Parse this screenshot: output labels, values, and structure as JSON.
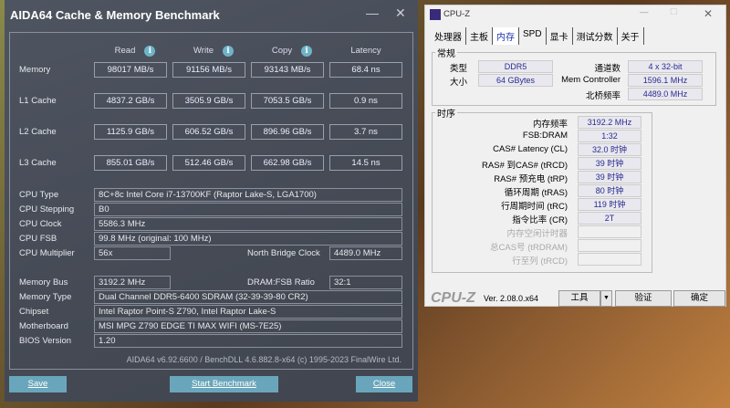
{
  "aida": {
    "title": "AIDA64 Cache & Memory Benchmark",
    "minimize": "—",
    "close_x": "✕",
    "headers": [
      "Read",
      "Write",
      "Copy",
      "Latency"
    ],
    "info_icon": "i",
    "rows": [
      {
        "label": "Memory",
        "values": [
          "98017 MB/s",
          "91156 MB/s",
          "93143 MB/s",
          "68.4 ns"
        ]
      },
      {
        "label": "L1 Cache",
        "values": [
          "4837.2 GB/s",
          "3505.9 GB/s",
          "7053.5 GB/s",
          "0.9 ns"
        ]
      },
      {
        "label": "L2 Cache",
        "values": [
          "1125.9 GB/s",
          "606.52 GB/s",
          "896.96 GB/s",
          "3.7 ns"
        ]
      },
      {
        "label": "L3 Cache",
        "values": [
          "855.01 GB/s",
          "512.46 GB/s",
          "662.98 GB/s",
          "14.5 ns"
        ]
      }
    ],
    "cpu_type_label": "CPU Type",
    "cpu_type": "8C+8c Intel Core i7-13700KF  (Raptor Lake-S, LGA1700)",
    "cpu_stepping_label": "CPU Stepping",
    "cpu_stepping": "B0",
    "cpu_clock_label": "CPU Clock",
    "cpu_clock": "5586.3 MHz",
    "cpu_fsb_label": "CPU FSB",
    "cpu_fsb": "99.8 MHz  (original: 100 MHz)",
    "cpu_mult_label": "CPU Multiplier",
    "cpu_mult": "56x",
    "nb_clock_label": "North Bridge Clock",
    "nb_clock": "4489.0 MHz",
    "mem_bus_label": "Memory Bus",
    "mem_bus": "3192.2 MHz",
    "ratio_label": "DRAM:FSB Ratio",
    "ratio": "32:1",
    "mem_type_label": "Memory Type",
    "mem_type": "Dual Channel DDR5-6400 SDRAM  (32-39-39-80 CR2)",
    "chipset_label": "Chipset",
    "chipset": "Intel Raptor Point-S Z790, Intel Raptor Lake-S",
    "mobo_label": "Motherboard",
    "mobo": "MSI MPG Z790 EDGE TI MAX WIFI (MS-7E25)",
    "bios_label": "BIOS Version",
    "bios": "1.20",
    "footer": "AIDA64 v6.92.6600 / BenchDLL 4.6.882.8-x64  (c) 1995-2023 FinalWire Ltd.",
    "save": "Save",
    "start": "Start Benchmark",
    "close": "Close"
  },
  "cpuz": {
    "title": "CPU-Z",
    "tabs": [
      "处理器",
      "主板",
      "内存",
      "SPD",
      "显卡",
      "测试分数",
      "关于"
    ],
    "general": "常规",
    "type_label": "类型",
    "type": "DDR5",
    "size_label": "大小",
    "size": "64 GBytes",
    "channels_label": "通道数",
    "channels": "4 x 32-bit",
    "memctrl_label": "Mem Controller",
    "memctrl": "1596.1 MHz",
    "nb_label": "北桥频率",
    "nb": "4489.0 MHz",
    "timings": "时序",
    "timing_rows": [
      {
        "label": "内存频率",
        "value": "3192.2 MHz"
      },
      {
        "label": "FSB:DRAM",
        "value": "1:32"
      },
      {
        "label": "CAS# Latency (CL)",
        "value": "32.0 时钟"
      },
      {
        "label": "RAS# 到CAS# (tRCD)",
        "value": "39 时钟"
      },
      {
        "label": "RAS# 预充电 (tRP)",
        "value": "39 时钟"
      },
      {
        "label": "循环周期 (tRAS)",
        "value": "80 时钟"
      },
      {
        "label": "行周期时间 (tRC)",
        "value": "119 时钟"
      },
      {
        "label": "指令比率 (CR)",
        "value": "2T"
      },
      {
        "label": "内存空闲计时器",
        "value": ""
      },
      {
        "label": "总CAS号 (tRDRAM)",
        "value": ""
      },
      {
        "label": "行至列 (tRCD)",
        "value": ""
      }
    ],
    "logo": "CPU-Z",
    "version": "Ver. 2.08.0.x64",
    "tools": "工具",
    "validate": "验证",
    "ok": "确定"
  }
}
